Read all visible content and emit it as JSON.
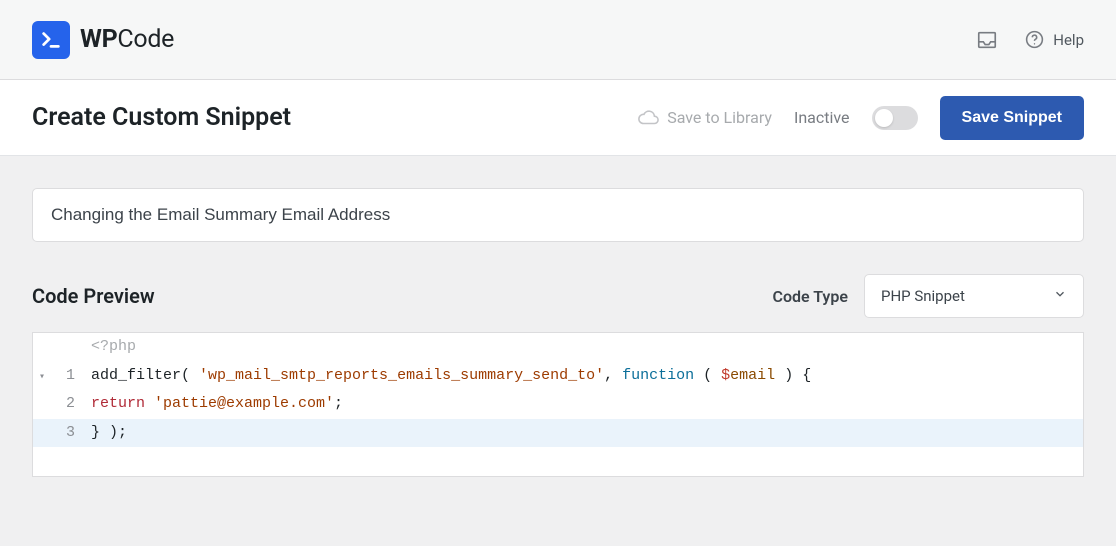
{
  "brand": {
    "prefix": "WP",
    "suffix": "Code"
  },
  "topbar": {
    "help_label": "Help"
  },
  "subheader": {
    "title": "Create Custom Snippet",
    "save_library_label": "Save to Library",
    "inactive_label": "Inactive",
    "save_button_label": "Save Snippet"
  },
  "snippet": {
    "title_value": "Changing the Email Summary Email Address"
  },
  "preview": {
    "title": "Code Preview",
    "codetype_label": "Code Type",
    "codetype_value": "PHP Snippet"
  },
  "code": {
    "pretag": "<?php",
    "lines": {
      "l1": {
        "num": "1",
        "fn": "add_filter",
        "p_open": "( ",
        "str": "'wp_mail_smtp_reports_emails_summary_send_to'",
        "comma": ", ",
        "kw": "function ",
        "open2": "( ",
        "dollar": "$",
        "var": "email",
        "close2": " ) {",
        "after": ""
      },
      "l2": {
        "num": "2",
        "ret": "return ",
        "str": "'pattie@example.com'",
        "semi": ";"
      },
      "l3": {
        "num": "3",
        "text": "} );"
      }
    }
  }
}
